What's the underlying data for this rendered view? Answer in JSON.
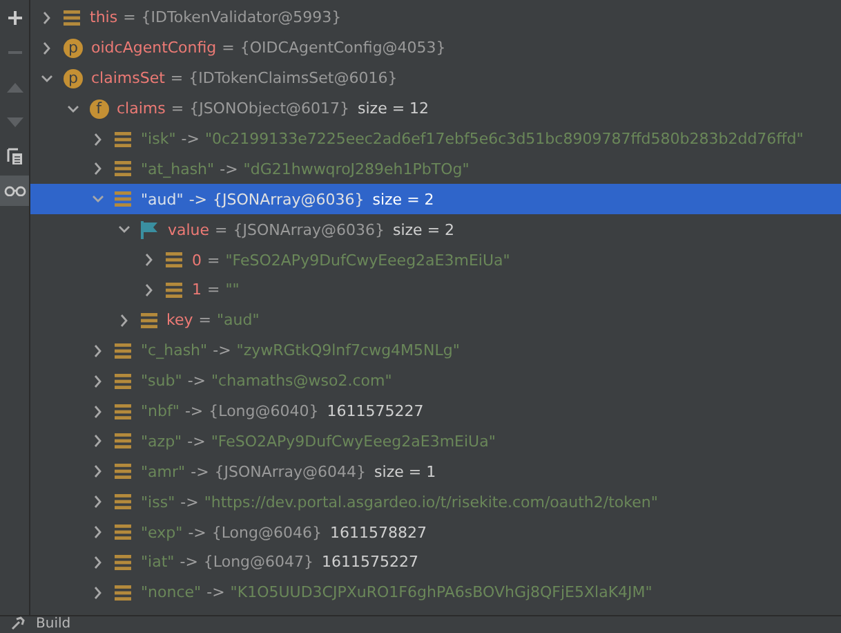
{
  "toolbar": [
    {
      "kind": "add",
      "disabled": false,
      "on": false
    },
    {
      "kind": "remove",
      "disabled": true,
      "on": false
    },
    {
      "kind": "up",
      "disabled": true,
      "on": false
    },
    {
      "kind": "down",
      "disabled": true,
      "on": false
    },
    {
      "kind": "copy",
      "disabled": false,
      "on": false
    },
    {
      "kind": "watch",
      "disabled": false,
      "on": true
    }
  ],
  "tree": [
    {
      "kind": "field",
      "name": "this",
      "op": "=",
      "ref": "{IDTokenValidator@5993}",
      "expanded": false,
      "selected": false
    },
    {
      "kind": "member",
      "badge": "p",
      "name": "oidcAgentConfig",
      "op": "=",
      "ref": "{OIDCAgentConfig@4053}",
      "expanded": false,
      "selected": false
    },
    {
      "kind": "member",
      "badge": "p",
      "name": "claimsSet",
      "op": "=",
      "ref": "{IDTokenClaimsSet@6016}",
      "expanded": true,
      "selected": false,
      "children": [
        {
          "kind": "member",
          "badge": "f",
          "name": "claims",
          "op": "=",
          "ref": "{JSONObject@6017}",
          "size": "size = 12",
          "expanded": true,
          "selected": false,
          "children": [
            {
              "kind": "entry",
              "name": "\"isk\"",
              "op": "->",
              "value": "\"0c2199133e7225eec2ad6ef17ebf5e6c3d51bc8909787ffd580b283b2dd76ffd\"",
              "expanded": false,
              "selected": false
            },
            {
              "kind": "entry",
              "name": "\"at_hash\"",
              "op": "->",
              "value": "\"dG21hwwqroJ289eh1PbTOg\"",
              "expanded": false,
              "selected": false
            },
            {
              "kind": "entry",
              "name": "\"aud\"",
              "op": "->",
              "ref": "{JSONArray@6036}",
              "size": "size = 2",
              "expanded": true,
              "selected": true,
              "children": [
                {
                  "kind": "flag",
                  "name": "value",
                  "op": "=",
                  "ref": "{JSONArray@6036}",
                  "size": "size = 2",
                  "expanded": true,
                  "selected": false,
                  "children": [
                    {
                      "kind": "field",
                      "name": "0",
                      "op": "=",
                      "value": "\"FeSO2APy9DufCwyEeeg2aE3mEiUa\"",
                      "expanded": false,
                      "selected": false
                    },
                    {
                      "kind": "field",
                      "name": "1",
                      "op": "=",
                      "value": "\"\"",
                      "expanded": false,
                      "selected": false
                    }
                  ]
                },
                {
                  "kind": "field",
                  "name": "key",
                  "op": "=",
                  "value": "\"aud\"",
                  "expanded": false,
                  "selected": false
                }
              ]
            },
            {
              "kind": "entry",
              "name": "\"c_hash\"",
              "op": "->",
              "value": "\"zywRGtkQ9lnf7cwg4M5NLg\"",
              "expanded": false,
              "selected": false
            },
            {
              "kind": "entry",
              "name": "\"sub\"",
              "op": "->",
              "value": "\"chamaths@wso2.com\"",
              "expanded": false,
              "selected": false
            },
            {
              "kind": "entry",
              "name": "\"nbf\"",
              "op": "->",
              "ref": "{Long@6040}",
              "value": "1611575227",
              "expanded": false,
              "selected": false
            },
            {
              "kind": "entry",
              "name": "\"azp\"",
              "op": "->",
              "value": "\"FeSO2APy9DufCwyEeeg2aE3mEiUa\"",
              "expanded": false,
              "selected": false
            },
            {
              "kind": "entry",
              "name": "\"amr\"",
              "op": "->",
              "ref": "{JSONArray@6044}",
              "size": "size = 1",
              "expanded": false,
              "selected": false
            },
            {
              "kind": "entry",
              "name": "\"iss\"",
              "op": "->",
              "value": "\"https://dev.portal.asgardeo.io/t/risekite.com/oauth2/token\"",
              "expanded": false,
              "selected": false
            },
            {
              "kind": "entry",
              "name": "\"exp\"",
              "op": "->",
              "ref": "{Long@6046}",
              "value": "1611578827",
              "expanded": false,
              "selected": false
            },
            {
              "kind": "entry",
              "name": "\"iat\"",
              "op": "->",
              "ref": "{Long@6047}",
              "value": "1611575227",
              "expanded": false,
              "selected": false
            },
            {
              "kind": "entry",
              "name": "\"nonce\"",
              "op": "->",
              "value": "\"K1O5UUD3CJPXuRO1F6ghPA6sBOVhGj8QFjE5XlaK4JM\"",
              "expanded": false,
              "selected": false
            }
          ]
        }
      ]
    }
  ],
  "bottom_tab": {
    "label": "Build"
  }
}
